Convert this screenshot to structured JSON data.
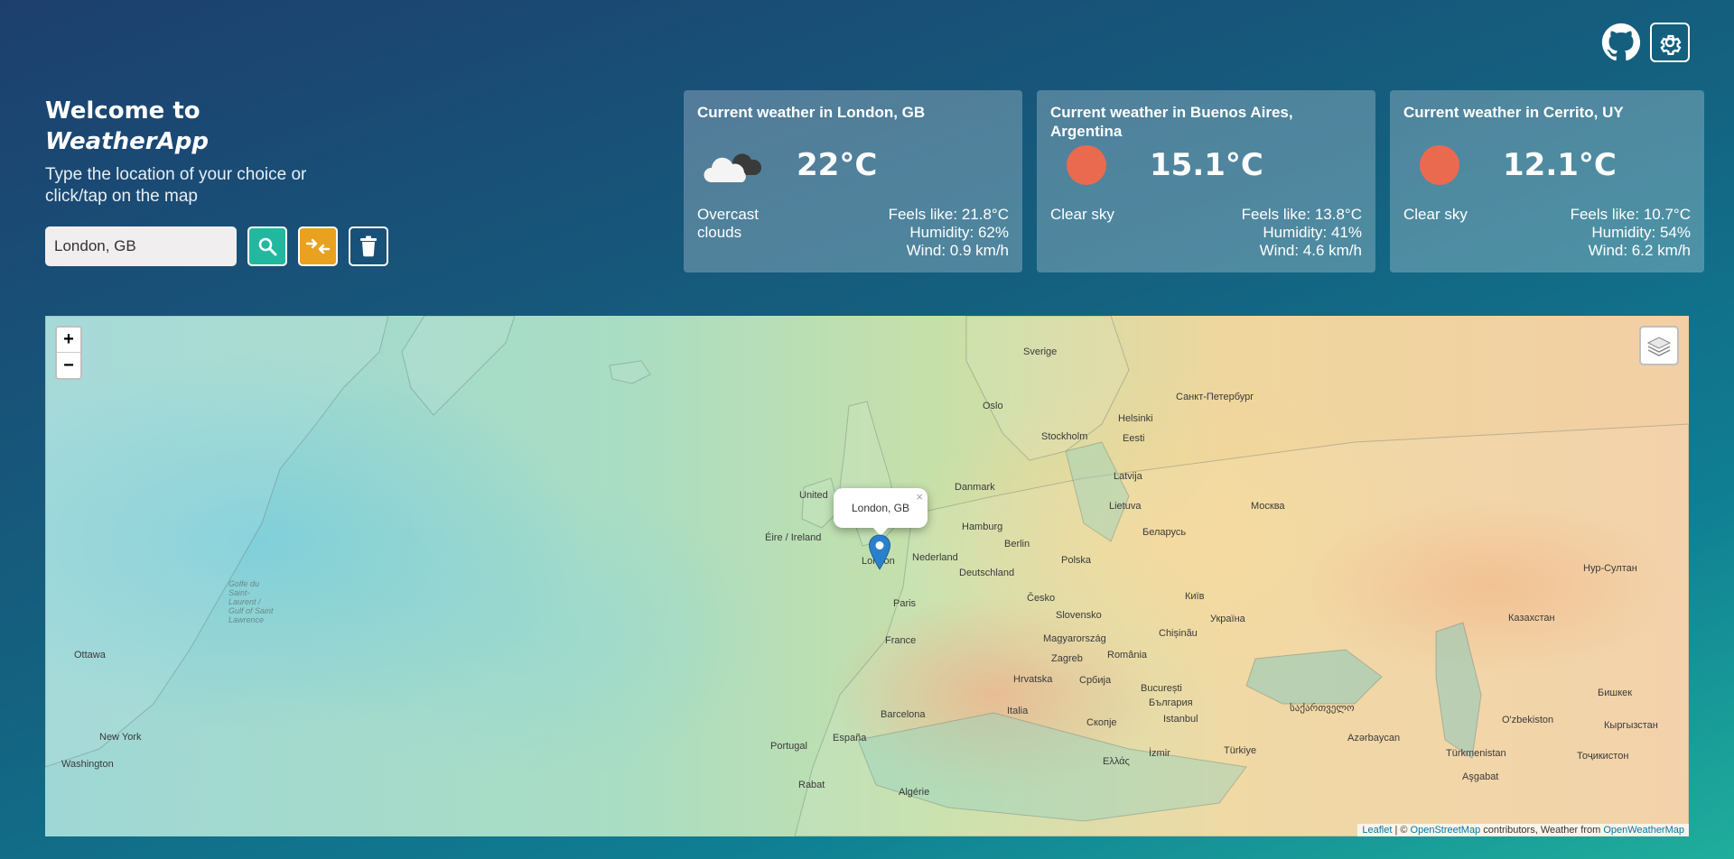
{
  "header": {
    "welcome": "Welcome to",
    "app_name": "WeatherApp",
    "instructions": "Type the location of your choice or click/tap on the map"
  },
  "search": {
    "value": "London, GB",
    "placeholder": ""
  },
  "icons": {
    "github": "github-icon",
    "settings": "gear-icon",
    "search": "search-icon",
    "swap": "swap-icon",
    "trash": "trash-icon",
    "layers": "layers-icon",
    "marker": "map-marker-icon"
  },
  "colors": {
    "search_button": "#22b8a0",
    "swap_button": "#e8a21f",
    "sun": "#ea6a4f",
    "marker": "#2a81cb"
  },
  "cards": [
    {
      "title": "Current weather in London, GB",
      "icon": "cloud-icon",
      "temp": "22°C",
      "description": "Overcast clouds",
      "feels_like": "Feels like: 21.8°C",
      "humidity": "Humidity: 62%",
      "wind": "Wind: 0.9 km/h"
    },
    {
      "title": "Current weather in Buenos Aires, Argentina",
      "icon": "sun-icon",
      "temp": "15.1°C",
      "description": "Clear sky",
      "feels_like": "Feels like: 13.8°C",
      "humidity": "Humidity: 41%",
      "wind": "Wind: 4.6 km/h"
    },
    {
      "title": "Current weather in Cerrito, UY",
      "icon": "sun-icon",
      "temp": "12.1°C",
      "description": "Clear sky",
      "feels_like": "Feels like: 10.7°C",
      "humidity": "Humidity: 54%",
      "wind": "Wind: 6.2 km/h"
    }
  ],
  "map": {
    "zoom_in": "+",
    "zoom_out": "−",
    "popup_text": "London, GB",
    "popup_close": "×",
    "attribution": {
      "leaflet": "Leaflet",
      "sep": " | © ",
      "osm": "OpenStreetMap",
      "mid": " contributors, Weather from ",
      "owm": "OpenWeatherMap"
    },
    "labels": [
      "Sverige",
      "Oslo",
      "Stockholm",
      "Helsinki",
      "Санкт-Петербург",
      "Eesti",
      "Latvija",
      "Lietuva",
      "Москва",
      "Беларусь",
      "Danmark",
      "Hamburg",
      "Berlin",
      "Polska",
      "Nederland",
      "Deutschland",
      "United",
      "Éire / Ireland",
      "London",
      "Paris",
      "France",
      "Česko",
      "Slovensko",
      "Magyarország",
      "Україна",
      "Київ",
      "Chișinău",
      "România",
      "Zagreb",
      "Hrvatska",
      "Србија",
      "București",
      "България",
      "Italia",
      "Barcelona",
      "España",
      "Portugal",
      "Istanbul",
      "Türkiye",
      "Казахстан",
      "Нур-Султан",
      "Бишкек",
      "Кыргызстан",
      "O'zbekiston",
      "Тоҷикистон",
      "Türkmenistan",
      "Aşgabat",
      "Azərbaycan",
      "საქართველო",
      "Скопје",
      "Ελλάς",
      "İzmir",
      "Algérie",
      "Rabat",
      "Ottawa",
      "New York",
      "Washington",
      "Golfe du Saint-Laurent / Gulf of Saint Lawrence"
    ]
  }
}
